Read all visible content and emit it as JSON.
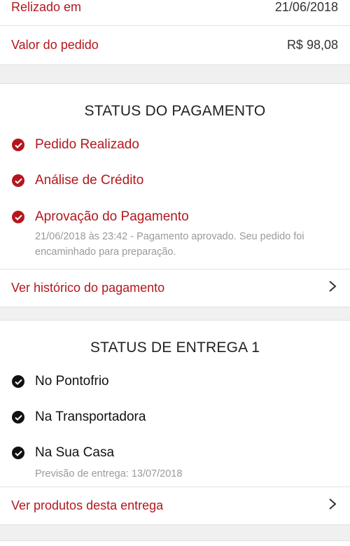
{
  "order": {
    "realized_label": "Relizado em",
    "realized_value": "21/06/2018",
    "amount_label": "Valor do pedido",
    "amount_value": "R$ 98,08"
  },
  "payment": {
    "title": "STATUS DO PAGAMENTO",
    "steps": [
      {
        "label": "Pedido Realizado",
        "icon": "check-circle-icon",
        "color": "#b3171d"
      },
      {
        "label": "Análise de Crédito",
        "icon": "check-circle-icon",
        "color": "#b3171d"
      },
      {
        "label": "Aprovação do Pagamento",
        "icon": "check-circle-icon",
        "color": "#b3171d",
        "detail": "21/06/2018 às 23:42 - Pagamento aprovado. Seu pedido foi encaminhado para preparação."
      }
    ],
    "history_link": "Ver histórico do pagamento"
  },
  "delivery": {
    "title": "STATUS DE ENTREGA 1",
    "steps": [
      {
        "label": "No Pontofrio",
        "icon": "check-circle-icon",
        "color": "#111111"
      },
      {
        "label": "Na Transportadora",
        "icon": "check-circle-icon",
        "color": "#111111"
      },
      {
        "label": "Na Sua Casa",
        "icon": "check-circle-icon",
        "color": "#111111",
        "detail": "Previsão de entrega: 13/07/2018"
      }
    ],
    "products_link": "Ver produtos desta entrega"
  },
  "colors": {
    "accent": "#b3171d",
    "text": "#111111",
    "muted": "#9a9a9a",
    "background": "#f0f0f0"
  }
}
